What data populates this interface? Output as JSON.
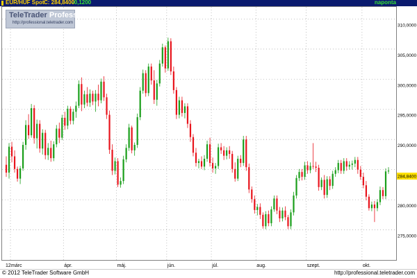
{
  "header": {
    "symbol": "EUR/HUF Spot",
    "last": "C: 284,8400",
    "change": "-0,1200",
    "period": "napontа"
  },
  "logo": {
    "brand_a": "TeleTrader",
    "brand_b": "Professional",
    "url": "http://professional.teletrader.com"
  },
  "footer": {
    "copyright": "© 2012 TeleTrader Software GmbH",
    "url": "http://professional.teletrader.com"
  },
  "colors": {
    "up": "#1a9e1a",
    "down": "#e8141c",
    "header_bg": "#0a1a6e",
    "last_price_bg": "#ffe000"
  },
  "chart_data": {
    "type": "candlestick",
    "title": "EUR/HUF Spot",
    "ylim": [
      270,
      312
    ],
    "yticks": [
      275,
      280,
      285,
      290,
      295,
      300,
      305,
      310
    ],
    "ytick_labels": [
      "275,0000",
      "280,0000",
      "285,0000",
      "290,0000",
      "295,0000",
      "300,0000",
      "305,0000",
      "310,0000"
    ],
    "x_months": [
      "12",
      "márc",
      "ápr.",
      "máj.",
      "jún.",
      "júl.",
      "aug.",
      "szept.",
      "okt."
    ],
    "x_month_start_index": [
      0,
      2,
      21,
      40,
      58,
      74,
      90,
      108,
      128
    ],
    "last_price_label": "284,8400",
    "last_price": 284.84,
    "grid": true,
    "candles": [
      [
        285.8,
        287.2,
        283.8,
        284.5
      ],
      [
        284.5,
        289.4,
        283.5,
        288.8
      ],
      [
        288.8,
        289.6,
        286.2,
        287.2
      ],
      [
        287.2,
        288.2,
        284.5,
        285.1
      ],
      [
        285.1,
        285.5,
        283.0,
        283.5
      ],
      [
        283.5,
        285.6,
        282.6,
        285.2
      ],
      [
        285.2,
        289.6,
        284.8,
        289.1
      ],
      [
        289.1,
        293.2,
        288.3,
        292.4
      ],
      [
        292.4,
        294.2,
        290.1,
        290.7
      ],
      [
        290.7,
        295.9,
        290.3,
        295.2
      ],
      [
        295.2,
        295.7,
        289.3,
        290.2
      ],
      [
        290.2,
        293.3,
        288.5,
        292.6
      ],
      [
        292.6,
        293.2,
        287.8,
        288.5
      ],
      [
        288.5,
        291.7,
        287.5,
        291.1
      ],
      [
        291.1,
        291.6,
        286.7,
        287.4
      ],
      [
        287.4,
        289.4,
        286.6,
        288.6
      ],
      [
        288.6,
        289.8,
        286.3,
        286.9
      ],
      [
        286.9,
        289.7,
        286.4,
        289.2
      ],
      [
        289.2,
        292.4,
        288.7,
        291.8
      ],
      [
        291.8,
        292.8,
        289.4,
        290.3
      ],
      [
        290.3,
        294.1,
        289.9,
        293.6
      ],
      [
        293.6,
        294.6,
        291.6,
        292.3
      ],
      [
        292.3,
        295.6,
        291.7,
        295.1
      ],
      [
        295.1,
        295.5,
        292.5,
        293.1
      ],
      [
        293.1,
        295.1,
        292.5,
        294.6
      ],
      [
        294.6,
        296.3,
        293.6,
        295.6
      ],
      [
        295.6,
        299.8,
        295.2,
        299.2
      ],
      [
        299.2,
        300.3,
        294.7,
        295.8
      ],
      [
        295.8,
        298.1,
        295.2,
        297.5
      ],
      [
        297.5,
        298.7,
        295.5,
        296.1
      ],
      [
        296.1,
        298.3,
        295.4,
        297.6
      ],
      [
        297.6,
        298.1,
        295.7,
        296.3
      ],
      [
        296.3,
        298.2,
        294.6,
        297.6
      ],
      [
        297.6,
        299.1,
        295.5,
        296.5
      ],
      [
        296.5,
        300.1,
        296.0,
        299.6
      ],
      [
        299.6,
        300.5,
        296.4,
        297.0
      ],
      [
        297.0,
        297.6,
        293.4,
        294.1
      ],
      [
        294.1,
        294.8,
        287.6,
        288.3
      ],
      [
        288.3,
        289.2,
        284.1,
        284.8
      ],
      [
        284.8,
        287.0,
        284.2,
        286.4
      ],
      [
        286.4,
        286.9,
        282.1,
        282.5
      ],
      [
        282.5,
        283.7,
        282.0,
        283.1
      ],
      [
        283.1,
        287.3,
        282.6,
        286.7
      ],
      [
        286.7,
        289.2,
        286.2,
        288.6
      ],
      [
        288.6,
        292.6,
        288.1,
        292.0
      ],
      [
        292.0,
        292.3,
        287.7,
        288.2
      ],
      [
        288.2,
        289.5,
        287.3,
        289.1
      ],
      [
        289.1,
        294.3,
        288.6,
        293.7
      ],
      [
        293.7,
        298.7,
        293.2,
        298.1
      ],
      [
        298.1,
        301.6,
        297.6,
        301.0
      ],
      [
        301.0,
        301.5,
        297.1,
        297.7
      ],
      [
        297.7,
        302.6,
        297.2,
        302.1
      ],
      [
        302.1,
        302.6,
        299.1,
        299.8
      ],
      [
        299.8,
        301.5,
        295.9,
        296.6
      ],
      [
        296.6,
        299.9,
        295.6,
        299.3
      ],
      [
        299.3,
        303.2,
        298.8,
        302.6
      ],
      [
        302.6,
        305.9,
        302.1,
        305.3
      ],
      [
        305.3,
        305.6,
        301.1,
        301.8
      ],
      [
        301.8,
        306.9,
        301.4,
        306.3
      ],
      [
        306.3,
        306.8,
        300.7,
        301.3
      ],
      [
        301.3,
        302.1,
        297.6,
        298.2
      ],
      [
        298.2,
        298.7,
        293.4,
        294.1
      ],
      [
        294.1,
        297.1,
        293.5,
        296.5
      ],
      [
        296.5,
        297.1,
        293.8,
        294.4
      ],
      [
        294.4,
        296.0,
        293.5,
        295.5
      ],
      [
        295.5,
        296.0,
        291.9,
        292.6
      ],
      [
        292.6,
        293.2,
        289.6,
        290.4
      ],
      [
        290.4,
        290.9,
        287.2,
        287.8
      ],
      [
        287.8,
        288.6,
        285.5,
        286.1
      ],
      [
        286.1,
        286.8,
        285.2,
        286.4
      ],
      [
        286.4,
        287.2,
        285.1,
        285.5
      ],
      [
        285.5,
        287.4,
        284.9,
        286.8
      ],
      [
        286.8,
        289.8,
        286.3,
        289.2
      ],
      [
        289.2,
        290.3,
        285.5,
        286.1
      ],
      [
        286.1,
        287.0,
        284.5,
        285.2
      ],
      [
        285.2,
        286.1,
        284.3,
        285.6
      ],
      [
        285.6,
        289.3,
        285.1,
        288.7
      ],
      [
        288.7,
        289.4,
        287.6,
        288.2
      ],
      [
        288.2,
        288.9,
        286.6,
        287.3
      ],
      [
        287.3,
        288.7,
        286.7,
        288.2
      ],
      [
        288.2,
        288.9,
        286.8,
        287.6
      ],
      [
        287.6,
        288.1,
        284.5,
        285.1
      ],
      [
        285.1,
        286.2,
        283.0,
        283.5
      ],
      [
        283.5,
        287.3,
        283.1,
        286.8
      ],
      [
        286.8,
        287.4,
        285.4,
        286.1
      ],
      [
        286.1,
        290.6,
        285.6,
        290.0
      ],
      [
        290.0,
        290.6,
        284.8,
        285.4
      ],
      [
        285.4,
        286.0,
        281.1,
        281.7
      ],
      [
        281.7,
        282.2,
        279.5,
        280.1
      ],
      [
        280.1,
        280.7,
        277.7,
        278.3
      ],
      [
        278.3,
        279.3,
        277.4,
        278.8
      ],
      [
        278.8,
        279.4,
        276.8,
        277.5
      ],
      [
        277.5,
        277.9,
        275.2,
        275.6
      ],
      [
        275.6,
        278.1,
        275.1,
        277.6
      ],
      [
        277.6,
        278.2,
        275.6,
        276.1
      ],
      [
        276.1,
        278.9,
        275.6,
        278.4
      ],
      [
        278.4,
        280.7,
        278.0,
        280.2
      ],
      [
        280.2,
        280.7,
        277.6,
        278.2
      ],
      [
        278.2,
        278.8,
        276.3,
        276.9
      ],
      [
        276.9,
        278.7,
        276.4,
        278.2
      ],
      [
        278.2,
        278.9,
        276.6,
        277.1
      ],
      [
        277.1,
        277.5,
        275.1,
        275.6
      ],
      [
        275.6,
        278.4,
        275.1,
        277.9
      ],
      [
        277.9,
        281.3,
        277.4,
        280.7
      ],
      [
        280.7,
        284.1,
        280.2,
        283.6
      ],
      [
        283.6,
        285.1,
        283.1,
        284.6
      ],
      [
        284.6,
        285.1,
        283.2,
        283.8
      ],
      [
        283.8,
        286.3,
        283.3,
        285.7
      ],
      [
        285.7,
        286.4,
        284.3,
        284.9
      ],
      [
        284.9,
        286.2,
        284.4,
        285.6
      ],
      [
        285.6,
        289.4,
        285.1,
        285.5
      ],
      [
        285.5,
        286.3,
        284.6,
        285.3
      ],
      [
        285.3,
        285.8,
        281.5,
        282.1
      ],
      [
        282.1,
        283.7,
        281.6,
        283.3
      ],
      [
        283.3,
        284.1,
        280.2,
        280.8
      ],
      [
        280.8,
        283.9,
        280.3,
        283.4
      ],
      [
        283.4,
        283.9,
        281.6,
        282.3
      ],
      [
        282.3,
        284.8,
        281.8,
        284.3
      ],
      [
        284.3,
        285.4,
        283.8,
        284.9
      ],
      [
        284.9,
        286.6,
        284.4,
        286.1
      ],
      [
        286.1,
        286.6,
        284.3,
        284.8
      ],
      [
        284.8,
        286.9,
        284.3,
        286.4
      ],
      [
        286.4,
        286.9,
        284.8,
        285.5
      ],
      [
        285.5,
        286.4,
        285.0,
        285.8
      ],
      [
        285.8,
        286.5,
        285.0,
        286.0
      ],
      [
        286.0,
        287.1,
        285.4,
        286.6
      ],
      [
        286.6,
        287.1,
        284.3,
        285.0
      ],
      [
        285.0,
        285.6,
        283.3,
        283.8
      ],
      [
        283.8,
        284.5,
        281.9,
        282.4
      ],
      [
        282.4,
        283.1,
        279.9,
        280.5
      ],
      [
        280.5,
        280.9,
        278.2,
        278.6
      ],
      [
        278.6,
        279.7,
        278.1,
        279.2
      ],
      [
        279.2,
        279.8,
        276.3,
        278.6
      ],
      [
        278.6,
        280.1,
        278.1,
        279.6
      ],
      [
        279.6,
        282.2,
        279.1,
        281.6
      ],
      [
        281.6,
        282.1,
        280.1,
        280.6
      ],
      [
        280.6,
        285.2,
        280.1,
        284.7
      ],
      [
        284.7,
        285.4,
        284.3,
        284.84
      ]
    ]
  }
}
